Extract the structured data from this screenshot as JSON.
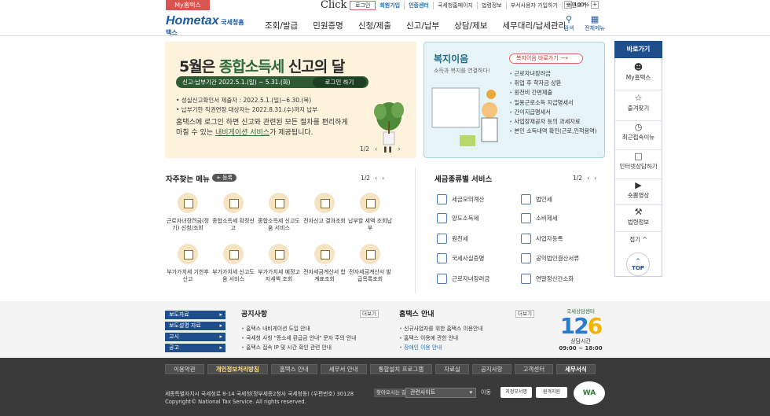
{
  "topbar": {
    "myhometax": "My홈택스",
    "click_label": "Click",
    "links": [
      "로그인",
      "회원가입",
      "인증센터",
      "국세청홈페이지",
      "법령정보",
      "부서사용자 가입하기",
      "화면크기"
    ],
    "zoom": "100%",
    "zoom_minus": "−",
    "zoom_plus": "+"
  },
  "header": {
    "logo_text": "Hometax",
    "logo_sub": "국세청홈택스",
    "gnb": [
      "조회/발급",
      "민원증명",
      "신청/제출",
      "신고/납부",
      "상담/제보",
      "세무대리/납세관리"
    ],
    "search_label": "검색",
    "allmenu_label": "전체메뉴"
  },
  "banner": {
    "title_prefix": "5월은 ",
    "title_highlight": "종합소득세",
    "title_suffix": " 신고의 달",
    "period": "신고·납부기간  2022.5.1.(일) ~ 5.31.(화)",
    "login_button": "로그인 하기",
    "notes": [
      "• 성실신고확인서 제출자 : 2022.5.1.(일)~6.30.(목)",
      "• 납부기한 직권연장 대상자는 2022.8.31.(수)까지 납부"
    ],
    "desc_line1": "홈택스에 로그인 하면 신고와 관련된 모든 절차를 편리하게",
    "desc_line2_a": "마칠 수 있는 ",
    "desc_line2_link": "내비게이션 서비스",
    "desc_line2_b": "가 제공됩니다.",
    "pager": "1/2",
    "prev": "‹",
    "pause": "❚❚",
    "next": "›"
  },
  "welfare": {
    "title": "복지이음",
    "subtitle": "소득과 복지를 연결하다!",
    "more_button": "복지이음 바로가기  ⟶",
    "items": [
      "근로자녀장려금",
      "취업 후 학자금 상환",
      "원천비 간편제출",
      "일용근로소득 지급명세서",
      "간이지급명세서",
      "사업장제공자 등의 과세자료",
      "본인 소득내역 확인(근로,인적용역)"
    ]
  },
  "quick": {
    "title": "바로가기",
    "items": [
      {
        "label": "My홈택스",
        "icon": "user-icon"
      },
      {
        "label": "즐겨찾기",
        "icon": "star-icon"
      },
      {
        "label": "최근접속이뉴",
        "icon": "clock-icon"
      },
      {
        "label": "인터넷상담하기",
        "icon": "chat-icon"
      },
      {
        "label": "숏뽐영상",
        "icon": "play-icon"
      },
      {
        "label": "법령정보",
        "icon": "gavel-icon"
      }
    ],
    "fold": "접기 ^",
    "top": "TOP"
  },
  "frequent": {
    "title": "자주찾는 메뉴",
    "register": "+ 등록",
    "pager": "1/2",
    "prev": "‹",
    "next": "›",
    "items": [
      "근로자녀장려금(정기) 신청/조회",
      "종합소득세 확정신고",
      "종합소득세 신고도움 서비스",
      "전자신고 결과조회",
      "납부할 세액 조회납부",
      "부가가치세 기한후 신고",
      "부가가치세 신고도움 서비스",
      "부가가치세 예정고지세액 조회",
      "전자세금계산서 합계표조회",
      "전자세금계산서 발급목록조회"
    ]
  },
  "taxservice": {
    "title": "세금종류별 서비스",
    "pager": "1/2",
    "prev": "‹",
    "next": "›",
    "left": [
      "세금모의계산",
      "양도소득세",
      "원천세",
      "국세사실증명",
      "근로자녀장려금"
    ],
    "right": [
      "법인세",
      "소비제세",
      "사업자등록",
      "공익법인결산서류",
      "연말정산간소화"
    ]
  },
  "notice": {
    "tabs": [
      "보도자료",
      "보도설명 자료",
      "고시",
      "공고"
    ],
    "title": "공지사항",
    "more": "더보기",
    "items": [
      "홈택스 내비게이션 도입 안내",
      "국세청 사칭 \"종소세 환급금 안내\" 문자 주의 안내",
      "홈택스 접속 IP 및 시간 확인 관련 안내"
    ]
  },
  "htnews": {
    "title": "홈택스 안내",
    "more": "더보기",
    "items": [
      "신규사업자를 위한 홈택스 이용안내",
      "홈택스 이용에 관한 안내",
      "장애인 이용 안내"
    ]
  },
  "callcenter": {
    "script": "국세상담센터",
    "number_a": "12",
    "number_b": "6",
    "hours_label": "상담시간",
    "hours": "09:00 ~ 18:00"
  },
  "footer": {
    "menu": [
      "이용약관",
      "개인정보처리방침",
      "홈택스 안내",
      "세무서 안내",
      "통합설치 프로그램",
      "자료실",
      "공지사항",
      "고객센터",
      "세무서식"
    ],
    "address": "세종특별자치시 국세청로 8-14 국세청(정부세종2청사 국세청동) (우편번호) 30128",
    "find_way": "찾아오시는 길",
    "copyright": "Copyright© National Tax Service. All rights reserved.",
    "related_select": "관련사이트",
    "go": "이동",
    "badge1": "지정부서명",
    "badge2": "원격지원",
    "wa": "WA"
  }
}
